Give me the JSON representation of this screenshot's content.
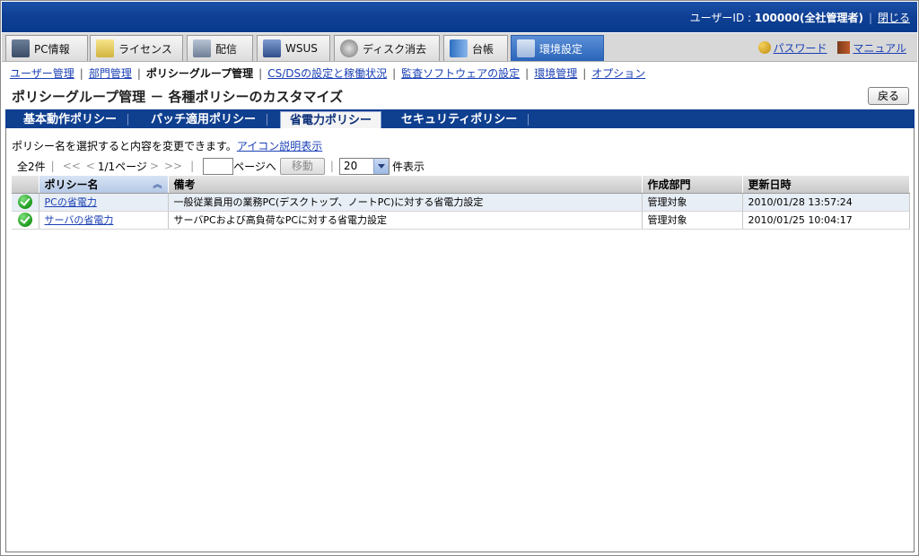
{
  "header": {
    "user_label": "ユーザーID : ",
    "user_value": "100000(全社管理者)",
    "close_label": "閉じる"
  },
  "main_tabs": [
    {
      "label": "PC情報",
      "icon": "pc-icon"
    },
    {
      "label": "ライセンス",
      "icon": "license-icon"
    },
    {
      "label": "配信",
      "icon": "distribution-icon"
    },
    {
      "label": "WSUS",
      "icon": "wsus-icon"
    },
    {
      "label": "ディスク消去",
      "icon": "disk-erase-icon"
    },
    {
      "label": "台帳",
      "icon": "ledger-icon"
    },
    {
      "label": "環境設定",
      "icon": "settings-icon",
      "active": true
    }
  ],
  "right_links": {
    "password": "パスワード",
    "manual": "マニュアル"
  },
  "sub_nav": {
    "items": [
      "ユーザー管理",
      "部門管理",
      "ポリシーグループ管理",
      "CS/DSの設定と稼働状況",
      "監査ソフトウェアの設定",
      "環境管理",
      "オプション"
    ],
    "current_index": 2
  },
  "page_title": "ポリシーグループ管理 － 各種ポリシーのカスタマイズ",
  "back_button": "戻る",
  "policy_tabs": [
    "基本動作ポリシー",
    "パッチ適用ポリシー",
    "省電力ポリシー",
    "セキュリティポリシー"
  ],
  "active_policy_tab": 2,
  "info": {
    "text": "ポリシー名を選択すると内容を変更できます。",
    "link": "アイコン説明表示"
  },
  "pager": {
    "total": "全2件",
    "first": "<<",
    "prev": "<",
    "page_info": "1/1ページ",
    "next": ">",
    "last": ">>",
    "page_input_value": "",
    "page_suffix": "ページへ",
    "move_button": "移動",
    "per_page": "20",
    "per_page_suffix": "件表示"
  },
  "table": {
    "columns": [
      "",
      "ポリシー名",
      "備考",
      "作成部門",
      "更新日時"
    ],
    "rows": [
      {
        "status": "ok",
        "name": "PCの省電力",
        "note": "一般従業員用の業務PC(デスクトップ、ノートPC)に対する省電力設定",
        "dept": "管理対象",
        "updated": "2010/01/28 13:57:24"
      },
      {
        "status": "ok",
        "name": "サーバの省電力",
        "note": "サーバPCおよび高負荷なPCに対する省電力設定",
        "dept": "管理対象",
        "updated": "2010/01/25 10:04:17"
      }
    ]
  },
  "colors": {
    "header_blue": "#0e3f94",
    "active_tab": "#2a65bb",
    "link": "#1a3fb5",
    "ok_green": "#1c9a1c"
  }
}
